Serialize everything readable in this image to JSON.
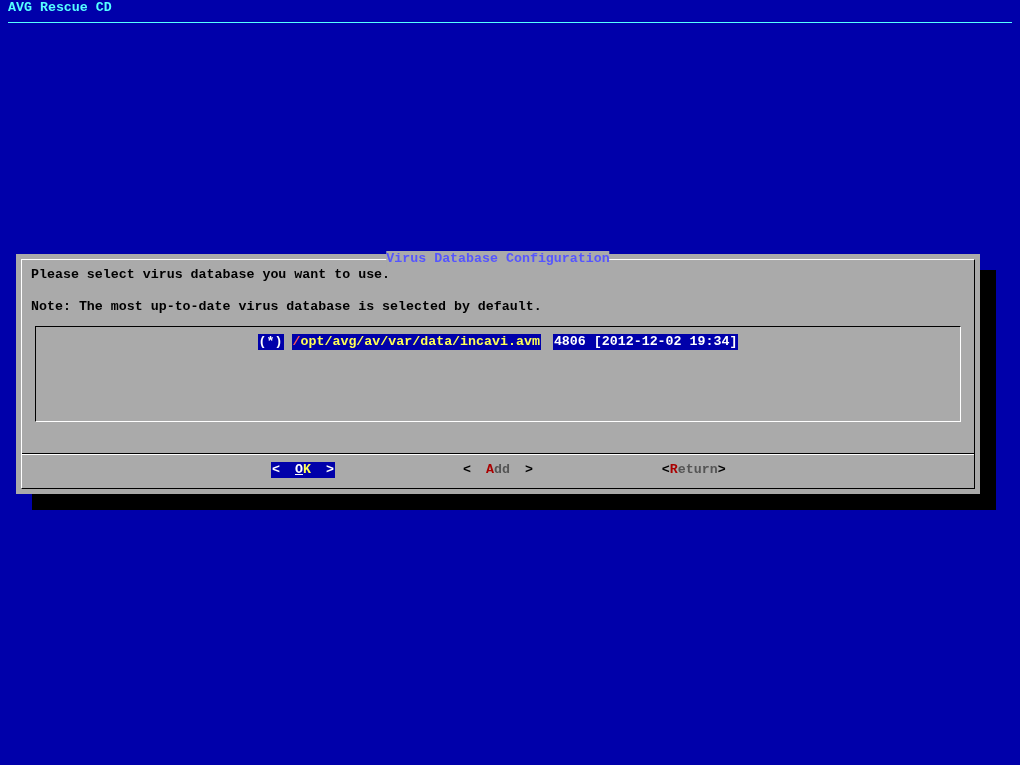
{
  "screen": {
    "title": "AVG Rescue CD"
  },
  "dialog": {
    "title": "Virus Database Configuration",
    "lines": [
      "Please select virus database you want to use.",
      "Note: The most up-to-date virus database is selected by default."
    ],
    "databases": [
      {
        "marker": "(*)",
        "path": "/opt/avg/av/var/data/incavi.avm",
        "info": "4806 [2012-12-02 19:34]",
        "selected": true
      }
    ],
    "buttons": [
      {
        "open": "<",
        "before": "O",
        "hotkey": "K",
        "close": ">",
        "selected": true
      },
      {
        "open": "<",
        "hotkey": "A",
        "after": "dd",
        "close": ">",
        "selected": false
      },
      {
        "open": "<",
        "hotkey": "R",
        "after": "eturn",
        "close": ">",
        "selected": false
      }
    ]
  }
}
